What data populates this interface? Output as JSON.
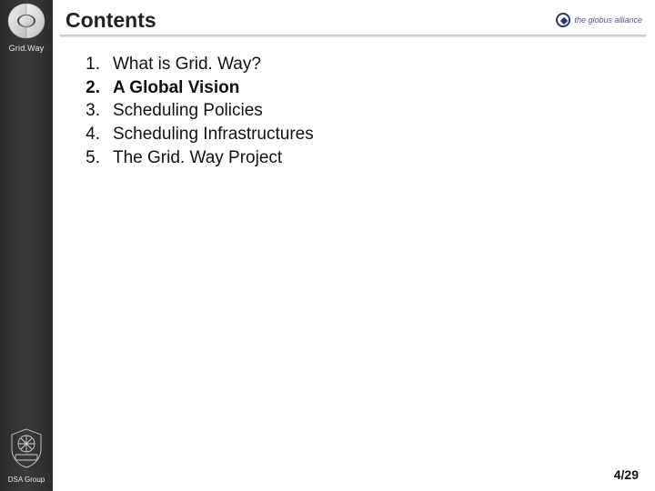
{
  "sidebar": {
    "top_label": "Grid.Way",
    "bottom_label": "DSA Group"
  },
  "header": {
    "title": "Contents",
    "right_brand": "the globus alliance"
  },
  "toc": {
    "items": [
      {
        "num": "1.",
        "label": "What is Grid. Way?",
        "current": false
      },
      {
        "num": "2.",
        "label": "A Global Vision",
        "current": true
      },
      {
        "num": "3.",
        "label": "Scheduling Policies",
        "current": false
      },
      {
        "num": "4.",
        "label": "Scheduling Infrastructures",
        "current": false
      },
      {
        "num": "5.",
        "label": "The Grid. Way Project",
        "current": false
      }
    ]
  },
  "footer": {
    "page": "4/29"
  }
}
